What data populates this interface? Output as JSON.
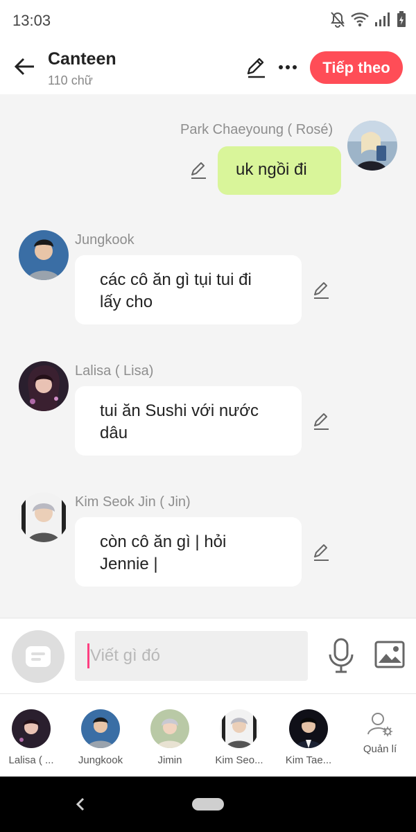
{
  "status_bar": {
    "time": "13:03",
    "icons": [
      "notifications-off-icon",
      "wifi-icon",
      "signal-icon",
      "battery-icon"
    ]
  },
  "header": {
    "title": "Canteen",
    "subtitle": "110 chữ",
    "next_label": "Tiếp theo",
    "accent_color": "#ff4d57"
  },
  "messages": [
    {
      "sender": "Park Chaeyoung ( Rosé)",
      "text_lines": [
        "uk ngồi đi"
      ],
      "own": true
    },
    {
      "sender": "Jungkook",
      "text_lines": [
        "các cô ăn gì tụi tui đi",
        "lấy cho"
      ],
      "own": false
    },
    {
      "sender": "Lalisa ( Lisa)",
      "text_lines": [
        "tui ăn Sushi với nước",
        "dâu"
      ],
      "own": false
    },
    {
      "sender": "Kim Seok Jin ( Jin)",
      "text_lines": [
        "còn cô ăn gì | hỏi",
        "Jennie |"
      ],
      "own": false
    }
  ],
  "composer": {
    "placeholder": "Viết gì đó"
  },
  "characters": [
    {
      "name": "Lalisa ( ..."
    },
    {
      "name": "Jungkook"
    },
    {
      "name": "Jimin"
    },
    {
      "name": "Kim Seo..."
    },
    {
      "name": "Kim Tae..."
    }
  ],
  "manage_label": "Quản lí",
  "own_bubble_color": "#d9f59a"
}
